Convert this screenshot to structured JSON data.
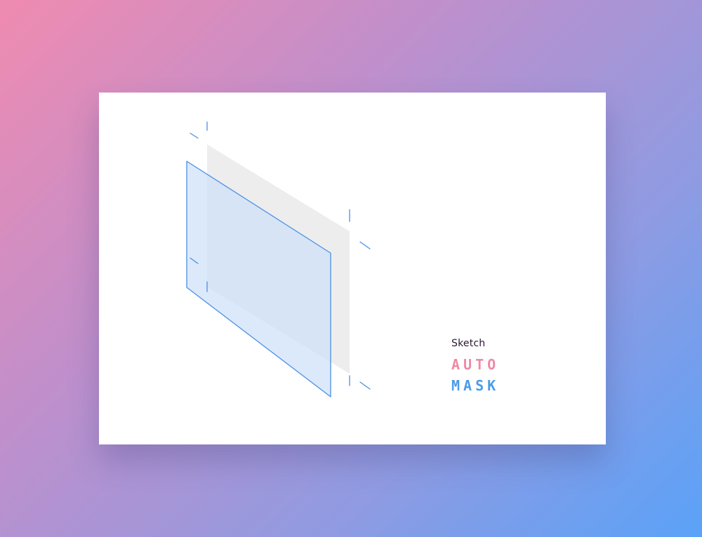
{
  "brand": {
    "name": "Sketch",
    "line1": "AUTO",
    "line2": "MASK"
  },
  "colors": {
    "background_start": "#f08bb0",
    "background_end": "#5aa2f8",
    "accent_pink": "#ee8aa6",
    "accent_blue": "#4d9be6",
    "outline_blue": "#4a90e2",
    "front_layer_fill": "#dce9fb",
    "back_layer_fill": "#ededed"
  },
  "icons": [
    "front-layer-icon",
    "back-layer-icon",
    "guide-marks-icon"
  ]
}
